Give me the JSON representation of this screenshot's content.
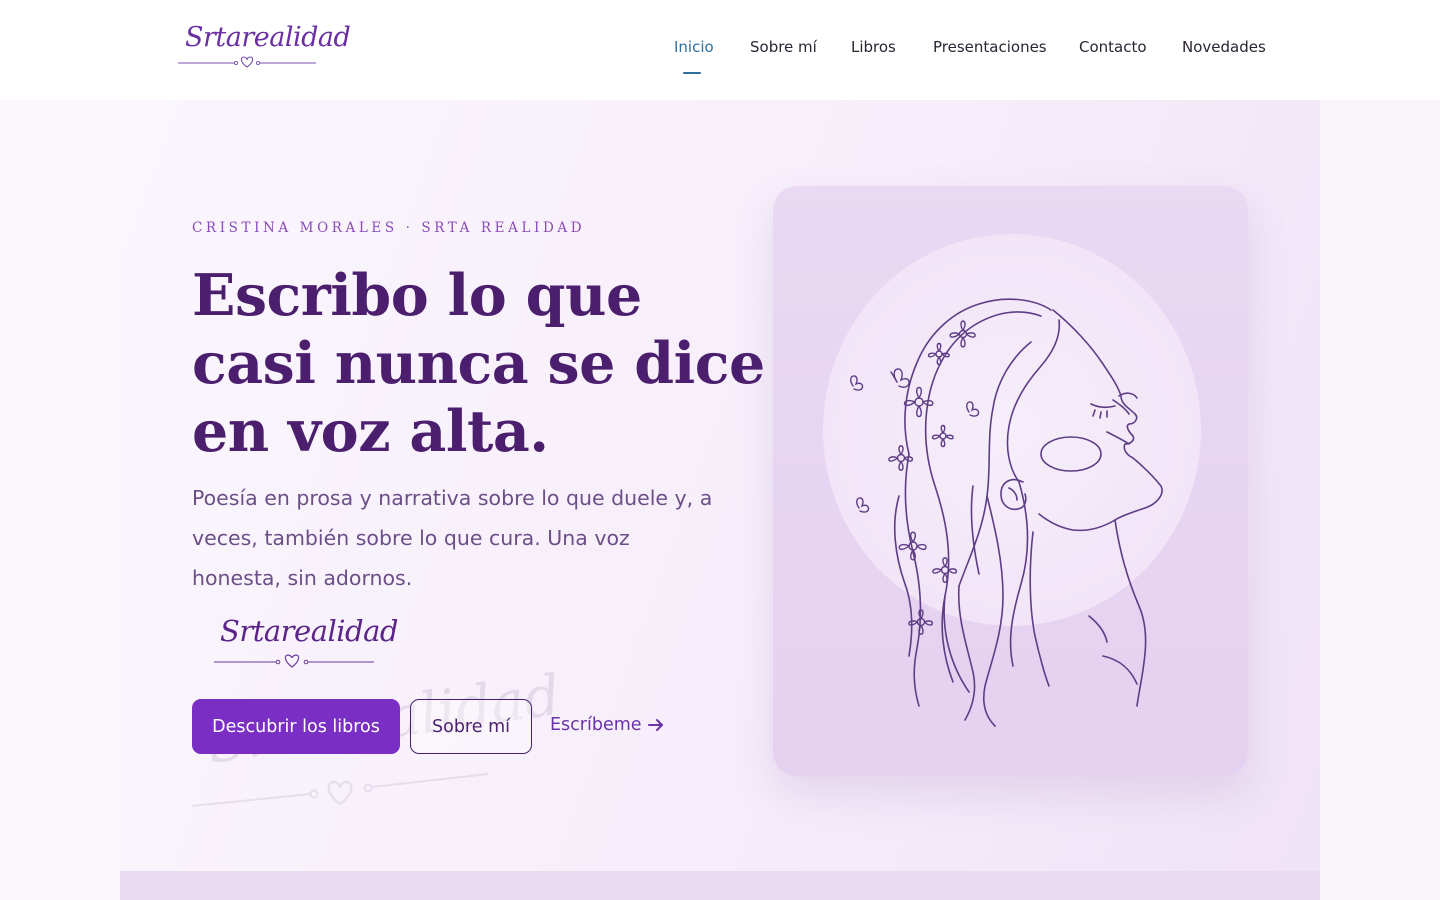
{
  "header": {
    "logo_text": "Srtarealidad",
    "nav": [
      {
        "label": "Inicio",
        "active": true
      },
      {
        "label": "Sobre mí",
        "active": false
      },
      {
        "label": "Libros",
        "active": false
      },
      {
        "label": "Presentaciones",
        "active": false
      },
      {
        "label": "Contacto",
        "active": false
      },
      {
        "label": "Novedades",
        "active": false
      }
    ]
  },
  "hero": {
    "eyebrow": "CRISTINA MORALES · SRTA REALIDAD",
    "headline": [
      "Escribo lo que",
      "casi nunca se dice",
      "en voz alta."
    ],
    "lead": "Poesía en prosa y narrativa sobre lo que duele y, a veces, también sobre lo que cura. Una voz honesta, sin adornos.",
    "signature": "Srtarealidad",
    "ghost_signature": "Srtarealidad",
    "buttons": {
      "primary": "Descubrir los libros",
      "secondary": "Sobre mí",
      "link": "Escríbeme",
      "link_icon": "arrow-right-icon"
    }
  },
  "colors": {
    "brand_purple": "#7a2ec4",
    "headline": "#4b1f6e",
    "nav_active": "#2f6f9c",
    "card_bg": "#e6d4f1"
  }
}
